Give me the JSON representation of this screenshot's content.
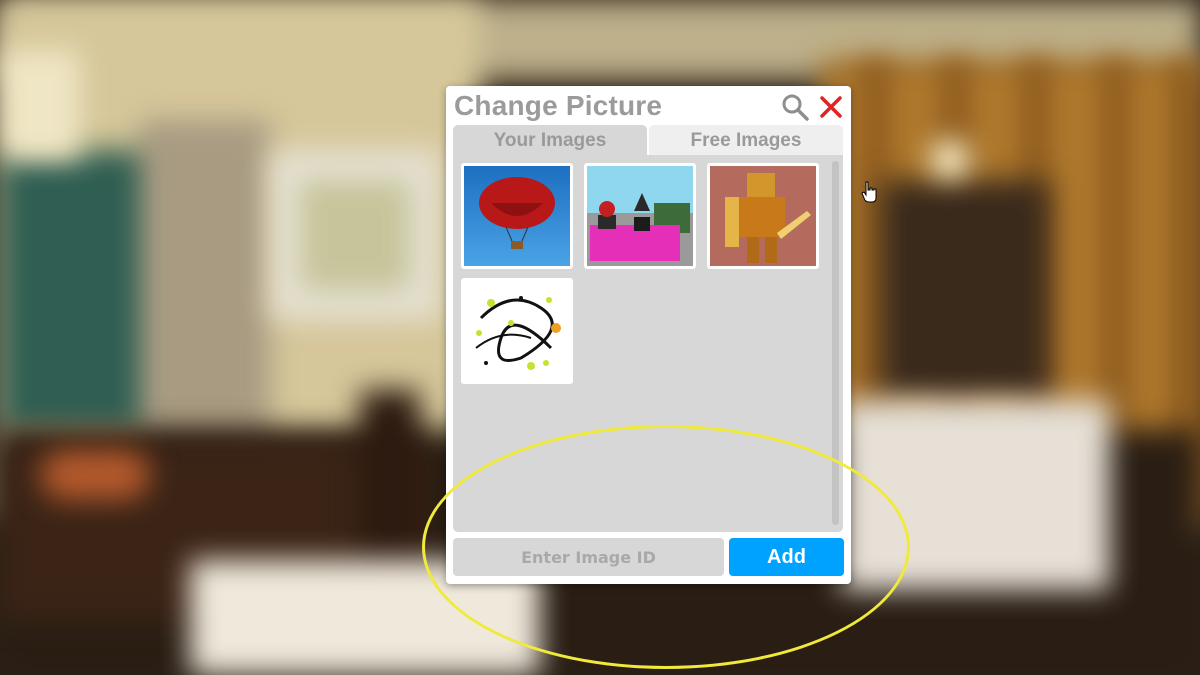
{
  "dialog": {
    "title": "Change Picture",
    "search_icon": "search-icon",
    "close_icon": "close-icon",
    "close_color": "#e02424"
  },
  "tabs": [
    {
      "label": "Your Images",
      "active": true
    },
    {
      "label": "Free Images",
      "active": false
    }
  ],
  "images": [
    {
      "icon": "hot-air-balloon-image"
    },
    {
      "icon": "avatars-on-pink-couch-image"
    },
    {
      "icon": "golden-armored-knight-image"
    },
    {
      "icon": "paint-splatter-image"
    }
  ],
  "image_id_input": {
    "placeholder": "Enter Image ID",
    "value": ""
  },
  "add_button": {
    "label": "Add"
  },
  "colors": {
    "accent": "#00a2ff",
    "highlight_ring": "#f0ea3a",
    "title_text": "#9b9b9b"
  }
}
